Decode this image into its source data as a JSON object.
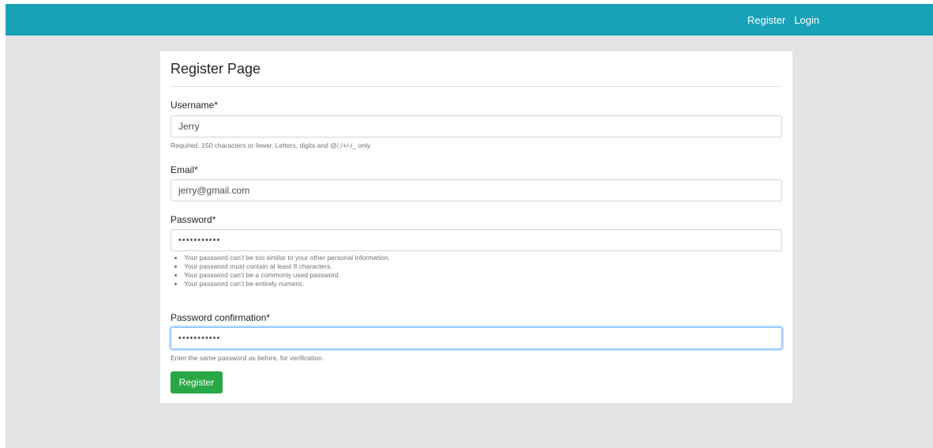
{
  "navbar": {
    "links": [
      {
        "label": "Register"
      },
      {
        "label": "Login"
      }
    ],
    "color": "#17a2b8"
  },
  "page": {
    "title": "Register Page",
    "background": "#e5e4e2"
  },
  "form": {
    "username": {
      "label": "Username*",
      "value": "Jerry",
      "help": "Required. 150 characters or fewer. Letters, digits and @/./+/-/_ only."
    },
    "email": {
      "label": "Email*",
      "value": "jerry@gmail.com"
    },
    "password": {
      "label": "Password*",
      "value": "•••••••••••",
      "help_items": [
        "Your password can’t be too similar to your other personal information.",
        "Your password must contain at least 8 characters.",
        "Your password can’t be a commonly used password.",
        "Your password can’t be entirely numeric."
      ]
    },
    "password_confirmation": {
      "label": "Password confirmation*",
      "value": "•••••••••••",
      "help": "Enter the same password as before, for verification.",
      "focused": true
    },
    "submit": {
      "label": "Register",
      "color": "#28a745"
    }
  }
}
